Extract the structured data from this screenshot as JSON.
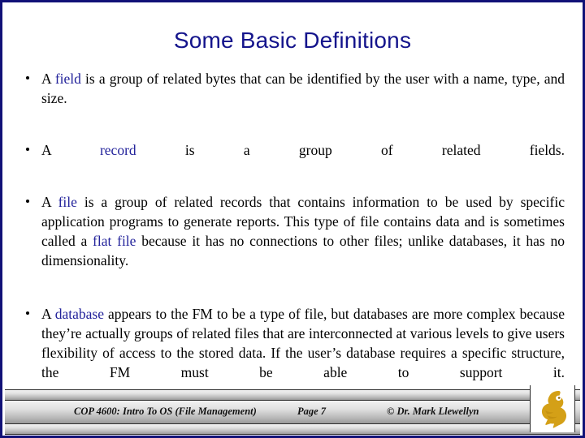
{
  "slide": {
    "title": "Some Basic Definitions",
    "title_color": "#14148c",
    "border_color": "#111177",
    "background": "#ffffff",
    "keyword_color": "#23239b"
  },
  "bullets": [
    {
      "id": "b1",
      "marker": "bullet-dot",
      "segments": [
        {
          "text": "A ",
          "style": "normal"
        },
        {
          "text": "field",
          "style": "keyword"
        },
        {
          "text": " is a group of related bytes that can be identified by the user with a name, type, and size.",
          "style": "normal"
        }
      ]
    },
    {
      "id": "b2",
      "marker": "bullet-dot",
      "segments": [
        {
          "text": "A ",
          "style": "normal"
        },
        {
          "text": "record",
          "style": "keyword"
        },
        {
          "text": " is a group of related fields.",
          "style": "normal"
        }
      ]
    },
    {
      "id": "b3",
      "marker": "bullet-dot",
      "segments": [
        {
          "text": "A ",
          "style": "normal"
        },
        {
          "text": "file",
          "style": "keyword"
        },
        {
          "text": " is a group of related records that contains information to be used by specific application programs to generate reports.  This type of file contains data and is sometimes called a ",
          "style": "normal"
        },
        {
          "text": "flat file",
          "style": "keyword"
        },
        {
          "text": " because it has no connections to other files; unlike databases, it has no dimensionality.",
          "style": "normal"
        }
      ]
    },
    {
      "id": "b4",
      "marker": "bullet-dot",
      "segments": [
        {
          "text": "A ",
          "style": "normal"
        },
        {
          "text": "database",
          "style": "keyword"
        },
        {
          "text": " appears to the FM to be a type of file, but databases are more complex because they’re actually groups of related files that are interconnected at various levels to give users flexibility of access to the stored data.  If the user’s database requires a specific structure, the FM must be able to support it.",
          "style": "normal"
        }
      ]
    }
  ],
  "footer": {
    "course": "COP 4600: Intro To OS  (File Management)",
    "page": "Page 7",
    "credit": "© Dr. Mark Llewellyn",
    "logo": "pegasus-logo",
    "logo_color": "#d4a017"
  }
}
